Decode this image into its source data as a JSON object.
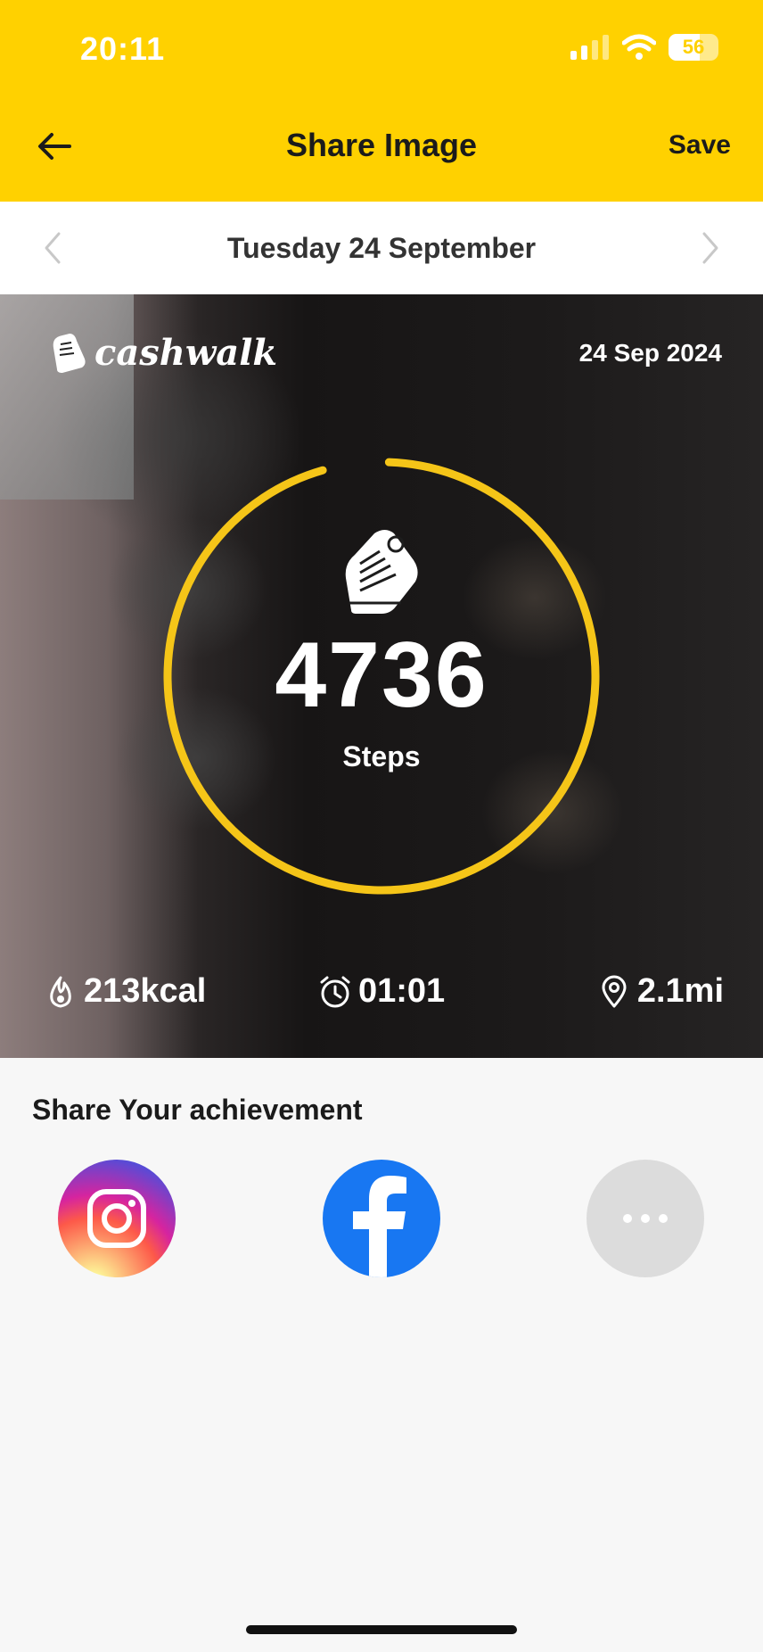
{
  "status_bar": {
    "time": "20:11",
    "battery": "56"
  },
  "header": {
    "title": "Share Image",
    "save_label": "Save"
  },
  "date_nav": {
    "label": "Tuesday 24 September"
  },
  "card": {
    "brand": "cashwalk",
    "date": "24 Sep 2024",
    "steps": "4736",
    "steps_label": "Steps",
    "goal_progress": 0.95,
    "stats": {
      "calories": "213kcal",
      "duration": "01:01",
      "distance": "2.1mi"
    }
  },
  "share": {
    "title": "Share Your achievement",
    "options": [
      "instagram-icon",
      "facebook-icon",
      "more-icon"
    ]
  },
  "colors": {
    "accent": "#FFD100",
    "ring": "#F5C518",
    "facebook": "#1877F2",
    "more": "#dcdcdc"
  }
}
